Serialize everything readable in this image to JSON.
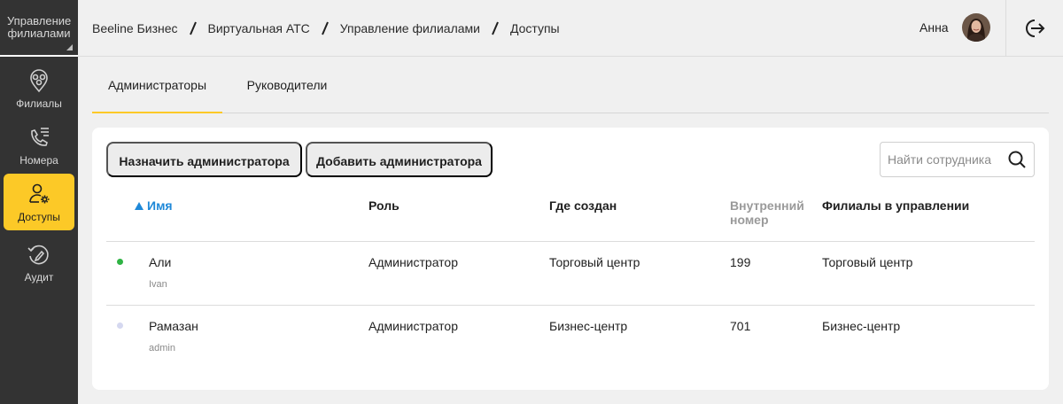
{
  "sidebar": {
    "header_title": "Управление филиалами",
    "items": [
      {
        "label": "Филиалы",
        "icon": "branches-pin-icon",
        "active": false
      },
      {
        "label": "Номера",
        "icon": "phone-list-icon",
        "active": false
      },
      {
        "label": "Доступы",
        "icon": "user-gear-icon",
        "active": true
      },
      {
        "label": "Аудит",
        "icon": "audit-icon",
        "active": false
      }
    ]
  },
  "breadcrumb": [
    "Beeline Бизнес",
    "Виртуальная АТС",
    "Управление филиалами",
    "Доступы"
  ],
  "user": {
    "name": "Анна"
  },
  "tabs": [
    {
      "label": "Администраторы",
      "active": true
    },
    {
      "label": "Руководители",
      "active": false
    }
  ],
  "toolbar": {
    "assign_label": "Назначить администратора",
    "add_label": "Добавить администратора",
    "search_placeholder": "Найти сотрудника"
  },
  "table": {
    "columns": [
      "Имя",
      "Роль",
      "Где создан",
      "Внутренний номер",
      "Филиалы в управлении"
    ],
    "sort": {
      "column": "Имя",
      "direction": "asc"
    },
    "rows": [
      {
        "name": "Али",
        "login": "Ivan",
        "role": "Администратор",
        "where": "Торговый центр",
        "ext": "199",
        "branches": "Торговый центр",
        "status": "online"
      },
      {
        "name": "Рамазан",
        "login": "admin",
        "role": "Администратор",
        "where": "Бизнес-центр",
        "ext": "701",
        "branches": "Бизнес-центр",
        "status": "offline"
      }
    ]
  },
  "colors": {
    "accent": "#fcc927",
    "sidebar_bg": "#333333",
    "sort_link": "#1e88d8",
    "status_online": "#2fb344",
    "status_offline": "#d5d8f0"
  }
}
